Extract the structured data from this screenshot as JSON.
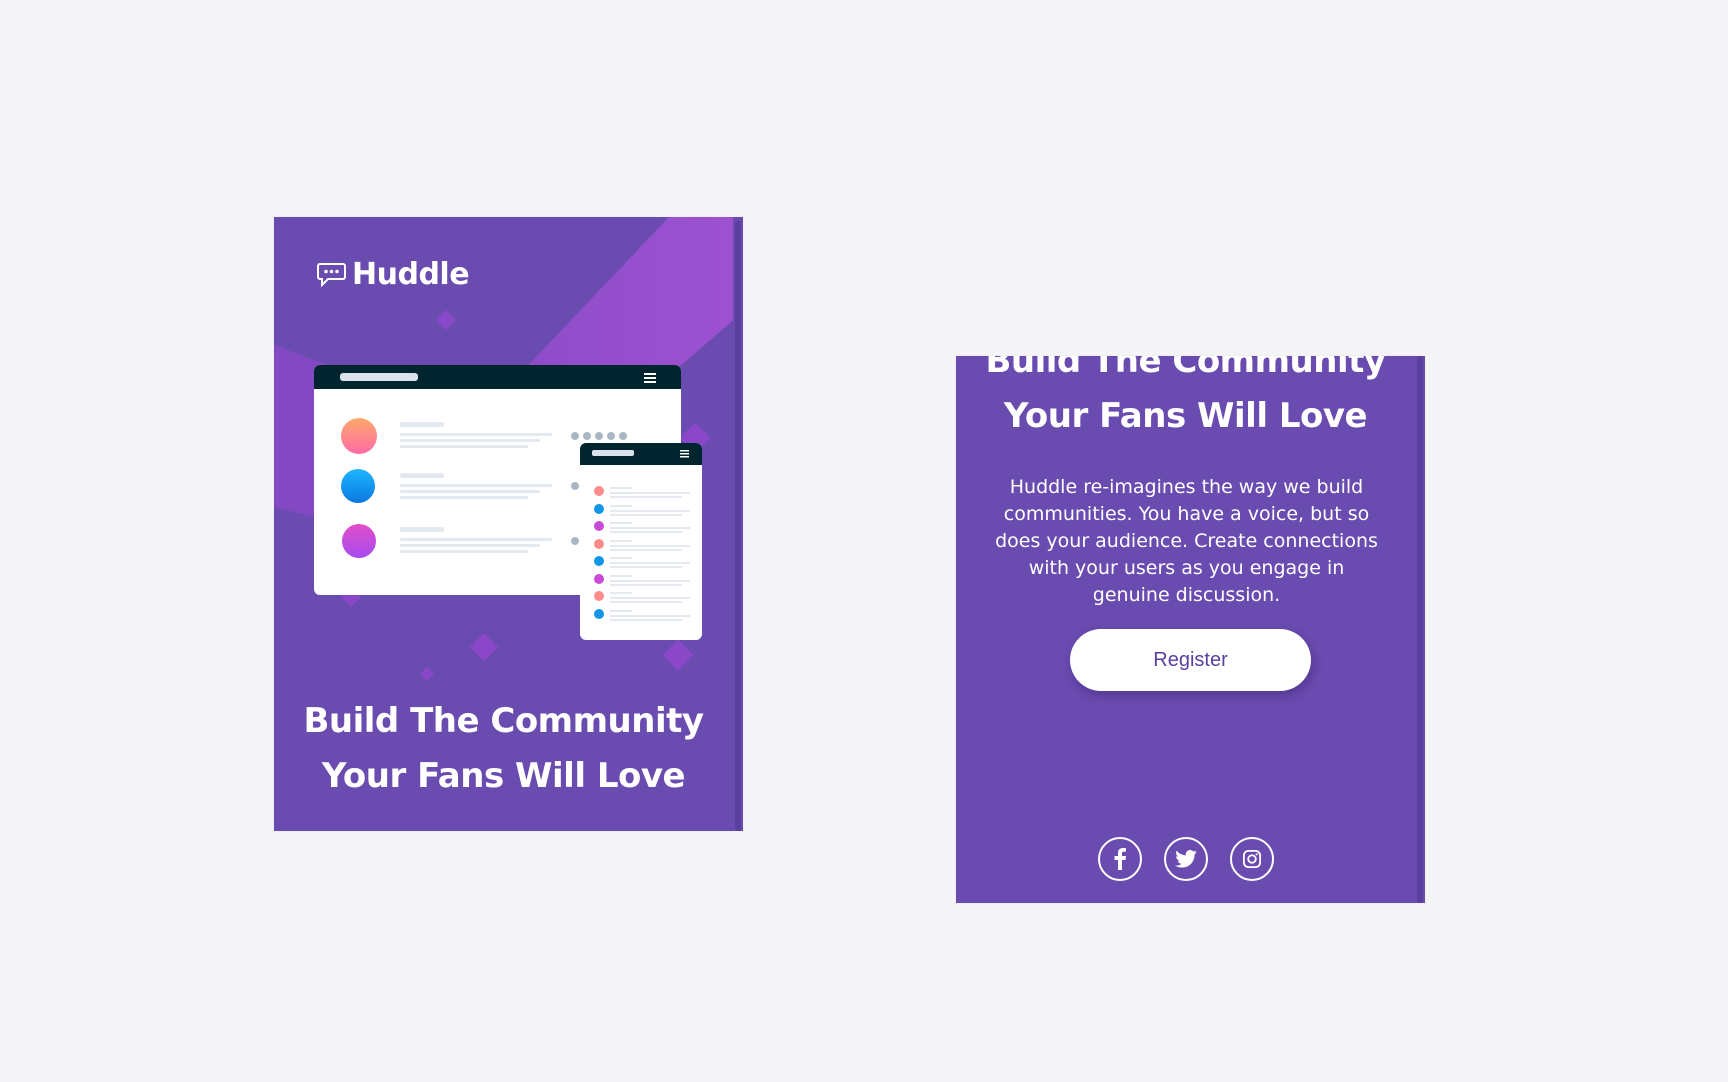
{
  "brand": {
    "name": "Huddle"
  },
  "hero": {
    "title_line1": "Build The Community",
    "title_line2": "Your Fans Will Love",
    "description": "Huddle re-imagines the way we build communities. You have a voice, but so does your audience. Create connections with your users as you engage in genuine discussion.",
    "register_label": "Register"
  },
  "socials": [
    "facebook-icon",
    "twitter-icon",
    "instagram-icon"
  ],
  "colors": {
    "background": "#f4f4f6",
    "primary_purple": "#6a4bb0",
    "accent_magenta": "#9b4fd1",
    "dark_header": "#00252e",
    "white": "#ffffff"
  }
}
